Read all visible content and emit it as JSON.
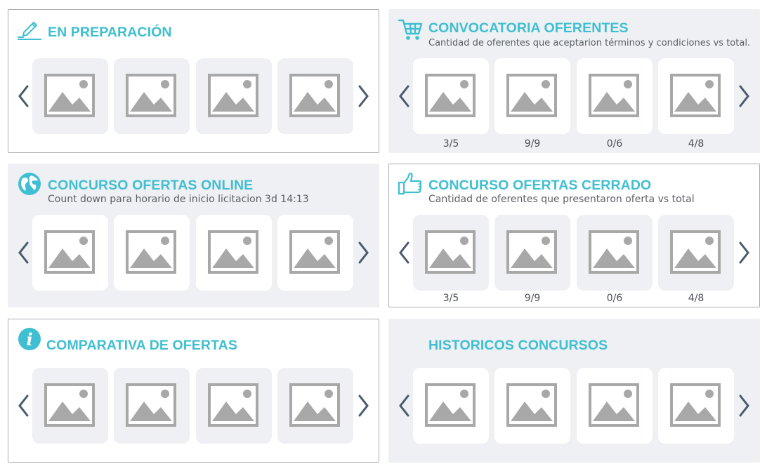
{
  "colors": {
    "accent": "#3fbfd1",
    "arrow": "#4a5a6e",
    "placeholder_gray": "#a8a8a8",
    "panel_gray": "#eef0f3",
    "panel_border": "#a9acb0"
  },
  "panels": {
    "preparacion": {
      "title": "EN PREPARACIÓN",
      "icon": "pen-icon"
    },
    "convocatoria": {
      "title": "CONVOCATORIA OFERENTES",
      "subtitle": "Cantidad de oferentes que aceptarion términos y condiciones vs total.",
      "icon": "cart-icon",
      "values": [
        "3/5",
        "9/9",
        "0/6",
        "4/8"
      ]
    },
    "online": {
      "title": "CONCURSO OFERTAS ONLINE",
      "subtitle": "Count down para horario de inicio licitacion 3d 14:13",
      "icon": "globe-icon"
    },
    "cerrado": {
      "title": "CONCURSO OFERTAS CERRADO",
      "subtitle": "Cantidad de oferentes que presentaron oferta vs total",
      "icon": "thumbs-up-icon",
      "values": [
        "3/5",
        "9/9",
        "0/6",
        "4/8"
      ]
    },
    "comparativa": {
      "title": "COMPARATIVA DE OFERTAS",
      "icon": "info-icon"
    },
    "historicos": {
      "title": "HISTORICOS CONCURSOS"
    }
  },
  "carousel": {
    "prev_icon": "chevron-left-icon",
    "next_icon": "chevron-right-icon",
    "thumb_icon": "image-placeholder-icon"
  }
}
